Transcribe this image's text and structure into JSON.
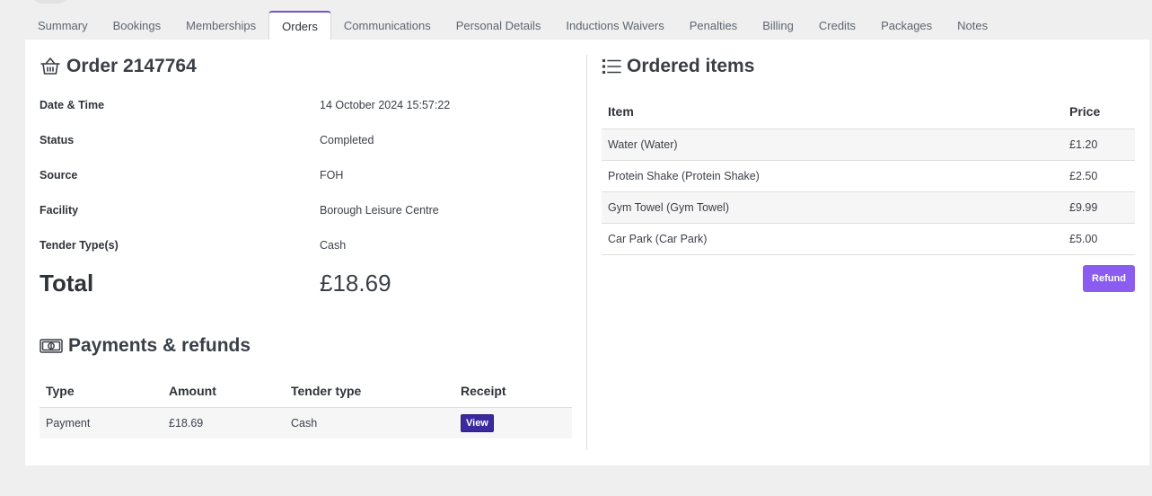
{
  "tabs": [
    {
      "label": "Summary"
    },
    {
      "label": "Bookings"
    },
    {
      "label": "Memberships"
    },
    {
      "label": "Orders"
    },
    {
      "label": "Communications"
    },
    {
      "label": "Personal Details"
    },
    {
      "label": "Inductions Waivers"
    },
    {
      "label": "Penalties"
    },
    {
      "label": "Billing"
    },
    {
      "label": "Credits"
    },
    {
      "label": "Packages"
    },
    {
      "label": "Notes"
    }
  ],
  "active_tab": "Orders",
  "order": {
    "title": "Order 2147764",
    "details": [
      {
        "label": "Date & Time",
        "value": "14 October 2024 15:57:22"
      },
      {
        "label": "Status",
        "value": "Completed"
      },
      {
        "label": "Source",
        "value": "FOH"
      },
      {
        "label": "Facility",
        "value": "Borough Leisure Centre"
      },
      {
        "label": "Tender Type(s)",
        "value": "Cash"
      }
    ],
    "total_label": "Total",
    "total_value": "£18.69"
  },
  "payments": {
    "title": "Payments & refunds",
    "columns": [
      "Type",
      "Amount",
      "Tender type",
      "Receipt"
    ],
    "rows": [
      {
        "type": "Payment",
        "amount": "£18.69",
        "tender": "Cash",
        "receipt_label": "View"
      }
    ]
  },
  "items": {
    "title": "Ordered items",
    "columns": [
      "Item",
      "Price"
    ],
    "rows": [
      {
        "item": "Water (Water)",
        "price": "£1.20"
      },
      {
        "item": "Protein Shake (Protein Shake)",
        "price": "£2.50"
      },
      {
        "item": "Gym Towel (Gym Towel)",
        "price": "£9.99"
      },
      {
        "item": "Car Park (Car Park)",
        "price": "£5.00"
      }
    ],
    "refund_label": "Refund"
  },
  "colors": {
    "accent": "#8b5cf0",
    "view_button": "#3b2a9e",
    "background": "#efefef"
  },
  "icons": {
    "order": "basket-icon",
    "payments": "banknote-icon",
    "items": "list-icon"
  }
}
